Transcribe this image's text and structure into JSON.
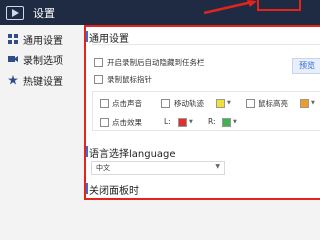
{
  "window": {
    "title": "设置"
  },
  "sidebar": {
    "items": [
      {
        "label": "通用设置",
        "icon": "grid-icon"
      },
      {
        "label": "录制选项",
        "icon": "camera-icon"
      },
      {
        "label": "热键设置",
        "icon": "star-icon"
      }
    ]
  },
  "general": {
    "title": "通用设置",
    "startup_minimize": "开启录制后自动隐藏到任务栏",
    "record_cursor": "录制鼠标指针",
    "preview_button": "预览",
    "click_sound": "点击声音",
    "move_track": "移动轨迹",
    "cursor_highlight": "鼠标高亮",
    "click_effect": "点击效果",
    "left_label": "L:",
    "right_label": "R:"
  },
  "language": {
    "title": "语言选择language",
    "selected": "中文"
  },
  "close_panel": {
    "title": "关闭面板时"
  },
  "colors": {
    "accent_red": "#e2241b",
    "move_track_color": "#f2df3a",
    "highlight_color": "#f09a2a",
    "left_color": "#e0302a",
    "right_color": "#42b34a"
  }
}
